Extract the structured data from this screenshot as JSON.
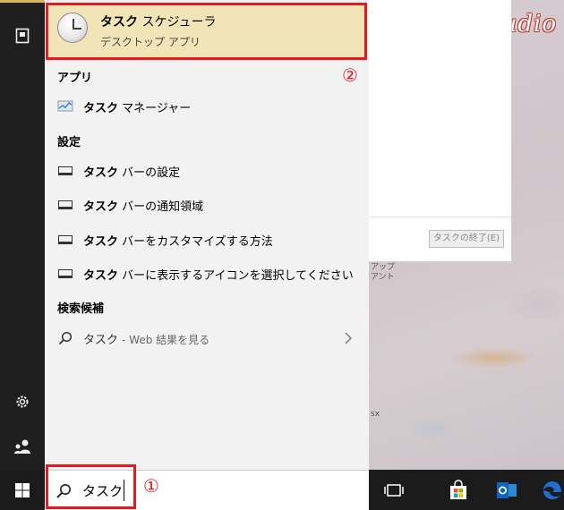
{
  "wallpaper": {
    "title": "M's Studio",
    "ghost_text_1": "アップ\nアント",
    "ghost_text_2": "sx"
  },
  "background_window": {
    "end_task_label": "タスクの終了(E)"
  },
  "best_match": {
    "title_highlight": "タスク",
    "title_rest": " スケジューラ",
    "subtitle": "デスクトップ アプリ"
  },
  "sections": {
    "apps": "アプリ",
    "settings": "設定",
    "suggestions": "検索候補"
  },
  "apps": [
    {
      "highlight": "タスク",
      "rest": " マネージャー",
      "icon": "task-manager-icon"
    }
  ],
  "settings": [
    {
      "highlight": "タスク",
      "rest": " バーの設定",
      "icon": "taskbar-icon"
    },
    {
      "highlight": "タスク",
      "rest": " バーの通知領域",
      "icon": "taskbar-icon"
    },
    {
      "highlight": "タスク",
      "rest": " バーをカスタマイズする方法",
      "icon": "taskbar-icon"
    },
    {
      "highlight": "タスク",
      "rest": " バーに表示するアイコンを選択してください",
      "icon": "taskbar-icon"
    }
  ],
  "web_suggestion": {
    "query": "タスク",
    "suffix": "- Web 結果を見る"
  },
  "search": {
    "value": "タスク"
  },
  "annotations": {
    "step1": "①",
    "step2": "②"
  },
  "colors": {
    "highlight_bg": "#f1e5b7",
    "annotation_red": "#e8191c",
    "taskbar": "#1b1b1b",
    "edge_blue": "#1e6fd0",
    "outlook_blue": "#0a64c0"
  }
}
